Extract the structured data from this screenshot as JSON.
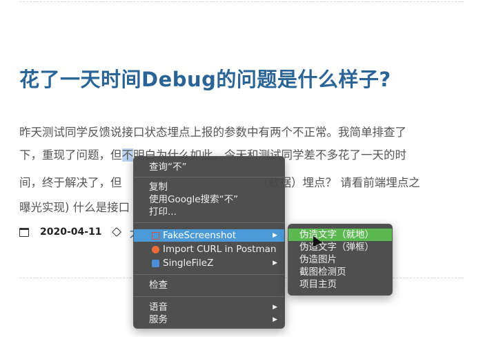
{
  "article": {
    "title": "花了一天时间Debug的问题是什么样子?",
    "para_line1": "昨天测试同学反馈说接口状态埋点上报的参数中有两个不正常。我简单排查了",
    "para_line2_a": "下，重现了问题，但",
    "para_line2_hl": "不",
    "para_line2_b": "明白为什么如此，今天和测试同学差不多花了一天的时",
    "para_line3_a": "间，终于解决了，但",
    "para_line3_b": "（数据）埋点？ 请看前端埋点之",
    "para_line4_a": "曝光实现) 什么是接口",
    "date": "2020-04-11",
    "tag": "大"
  },
  "context_menu": {
    "lookup": "查询“不”",
    "copy": "复制",
    "google_search": "使用Google搜索“不”",
    "print": "打印...",
    "fake_screenshot": "FakeScreenshot",
    "import_curl": "Import CURL in Postman",
    "singlefilez": "SingleFileZ",
    "inspect": "检查",
    "speech": "语音",
    "services": "服务",
    "arrow": "▶"
  },
  "submenu": {
    "items": [
      "伪造文字（就地）",
      "伪造文字（弹框）",
      "伪造图片",
      "截图检测页",
      "项目主页"
    ]
  },
  "colors": {
    "title": "#2a6496",
    "menu_bg": "#484848",
    "highlight_blue": "#4a9ad8",
    "highlight_green": "#5cb851"
  }
}
